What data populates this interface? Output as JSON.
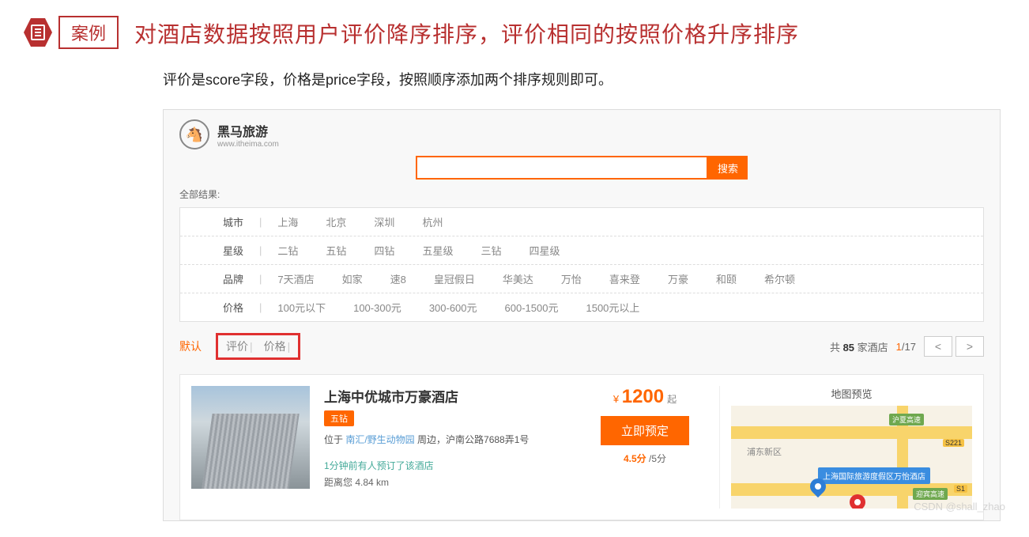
{
  "badge": {
    "label": "案例"
  },
  "title": "对酒店数据按照用户评价降序排序，评价相同的按照价格升序排序",
  "subtitle": "评价是score字段，价格是price字段，按照顺序添加两个排序规则即可。",
  "site": {
    "name": "黑马旅游",
    "domain": "www.itheima.com",
    "logo_glyph": "🐴"
  },
  "search": {
    "button": "搜索",
    "placeholder": ""
  },
  "all_results_label": "全部结果:",
  "filters": {
    "city": {
      "label": "城市",
      "items": [
        "上海",
        "北京",
        "深圳",
        "杭州"
      ]
    },
    "star": {
      "label": "星级",
      "items": [
        "二钻",
        "五钻",
        "四钻",
        "五星级",
        "三钻",
        "四星级"
      ]
    },
    "brand": {
      "label": "品牌",
      "items": [
        "7天酒店",
        "如家",
        "速8",
        "皇冠假日",
        "华美达",
        "万怡",
        "喜来登",
        "万豪",
        "和颐",
        "希尔顿"
      ]
    },
    "price": {
      "label": "价格",
      "items": [
        "100元以下",
        "100-300元",
        "300-600元",
        "600-1500元",
        "1500元以上"
      ]
    }
  },
  "sort": {
    "default": "默认",
    "by_rating": "评价",
    "by_price": "价格"
  },
  "pagination": {
    "prefix": "共 ",
    "count": "85",
    "suffix": " 家酒店",
    "current": "1",
    "sep": "/",
    "total": "17"
  },
  "hotel": {
    "name": "上海中优城市万豪酒店",
    "star_badge": "五钻",
    "location_prefix": "位于 ",
    "area": "南汇/野生动物园",
    "location_suffix": " 周边，沪南公路7688弄1号",
    "recent": "1分钟前有人预订了该酒店",
    "distance": "距离您 4.84 km",
    "currency": "¥",
    "price": "1200",
    "price_unit": "起",
    "book_btn": "立即预定",
    "score": "4.5分",
    "score_total": " /5分"
  },
  "map": {
    "title": "地图预览",
    "popup": "上海国际旅游度假区万怡酒店",
    "district": "浦东新区",
    "roads": {
      "huxia": "沪夏高速",
      "yingbin": "迎宾高速"
    },
    "signs": {
      "s221": "S221",
      "s1": "S1"
    }
  },
  "watermark": "CSDN @shall_zhao"
}
